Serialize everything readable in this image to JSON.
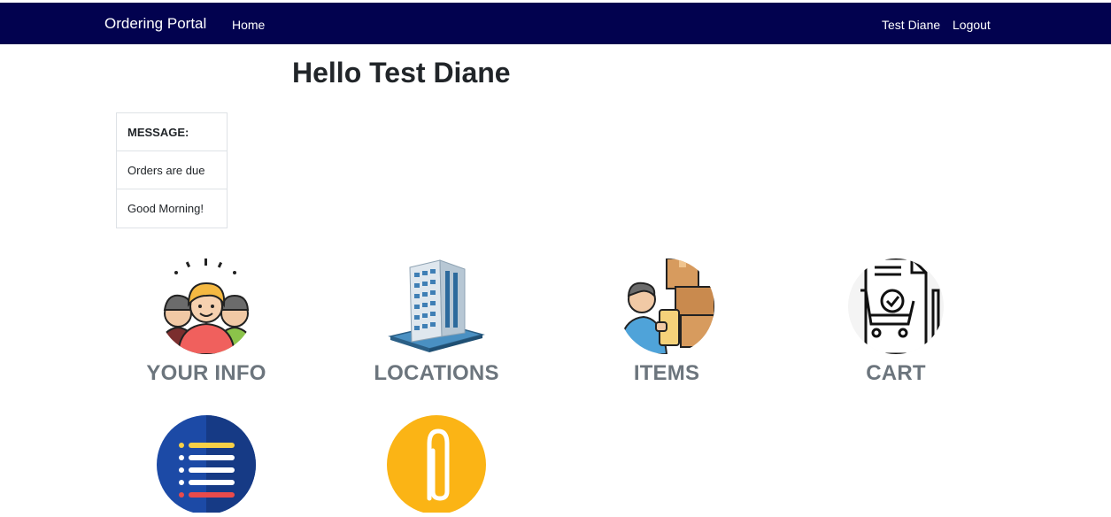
{
  "nav": {
    "brand": "Ordering Portal",
    "home": "Home",
    "user": "Test Diane",
    "logout": "Logout"
  },
  "greeting": "Hello Test Diane",
  "messages": {
    "header": "MESSAGE:",
    "items": [
      "Orders are due",
      "Good Morning!"
    ]
  },
  "tiles": [
    {
      "label": "YOUR INFO",
      "icon": "people-group-icon"
    },
    {
      "label": "LOCATIONS",
      "icon": "office-building-icon"
    },
    {
      "label": "ITEMS",
      "icon": "delivery-person-boxes-icon"
    },
    {
      "label": "CART",
      "icon": "document-cart-checkmark-icon"
    },
    {
      "label": "",
      "icon": "list-document-icon"
    },
    {
      "label": "",
      "icon": "paperclip-icon"
    }
  ],
  "colors": {
    "navbar": "#02024f",
    "tile_label": "#6c757d"
  }
}
